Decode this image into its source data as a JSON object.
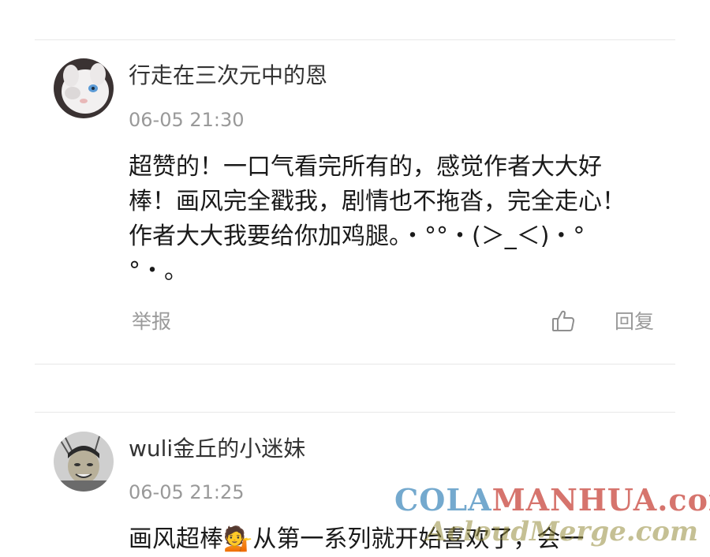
{
  "comments": [
    {
      "username": "行走在三次元中的恩",
      "timestamp": "06-05 21:30",
      "body": "超赞的！一口气看完所有的，感觉作者大大好棒！画风完全戳我，剧情也不拖沓，完全走心！作者大大我要给你加鸡腿。・°°・(＞_＜)・°°・。",
      "report_label": "举报",
      "reply_label": "回复",
      "avatar_icon": "white-cat-avatar",
      "like_icon": "thumbs-up-icon"
    },
    {
      "username": "wuli金丘的小迷妹",
      "timestamp": "06-05 21:25",
      "body": "画风超棒💁从第一系列就开始喜欢了，会一",
      "avatar_icon": "cartoon-face-avatar"
    }
  ],
  "watermark": {
    "cola": "COLA",
    "manhua": "MANHUA",
    "com": ".com",
    "line2": "AcloudMerge.com"
  },
  "colors": {
    "divider": "#e8e8e8",
    "meta_text": "#999999",
    "body_text": "#1a1a1a"
  }
}
